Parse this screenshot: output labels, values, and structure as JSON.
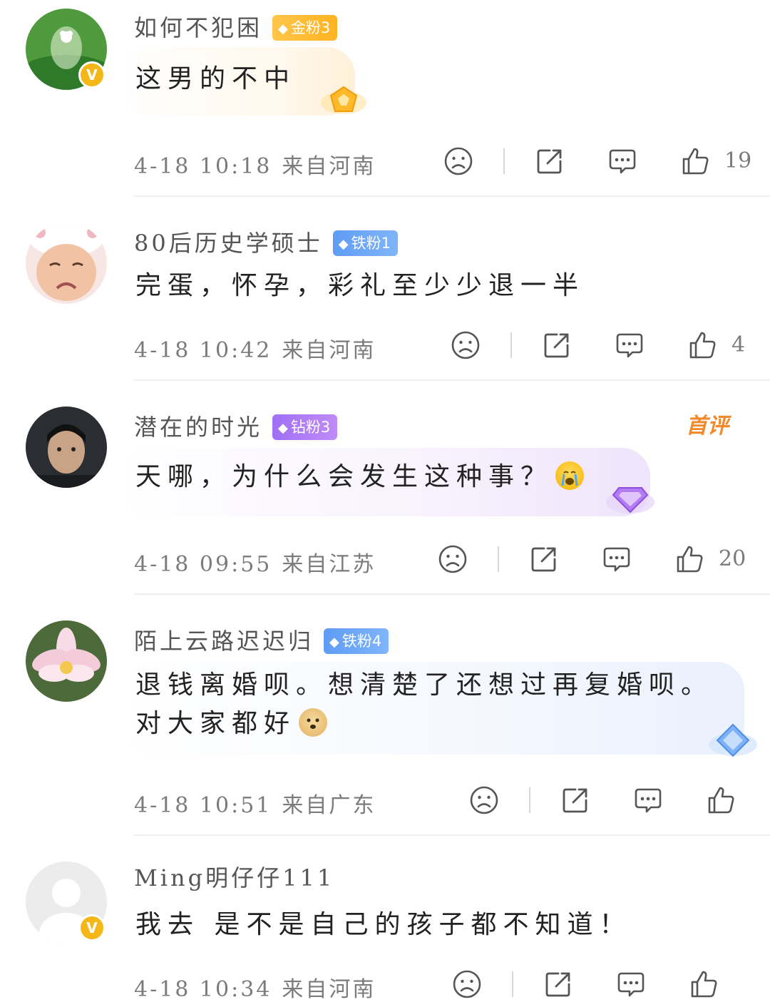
{
  "comments": [
    {
      "username": "如何不犯困",
      "badge": "金粉3",
      "text": "这男的不中",
      "time": "4-18 10:18",
      "location": "来自河南",
      "likes": "19",
      "verified": "V"
    },
    {
      "username": "80后历史学硕士",
      "badge": "铁粉1",
      "text": "完蛋，怀孕，彩礼至少少退一半",
      "time": "4-18 10:42",
      "location": "来自河南",
      "likes": "4"
    },
    {
      "username": "潜在的时光",
      "badge": "钻粉3",
      "text": "天哪，为什么会发生这种事？",
      "time": "4-18 09:55",
      "location": "来自江苏",
      "likes": "20",
      "tag": "首评"
    },
    {
      "username": "陌上云路迟迟归",
      "badge": "铁粉4",
      "text_line1": "退钱离婚呗。想清楚了还想过再复婚呗。",
      "text_line2": "对大家都好",
      "time": "4-18 10:51",
      "location": "来自广东",
      "likes": ""
    },
    {
      "username": "Ming明仔仔111",
      "text": "我去 是不是自己的孩子都不知道！",
      "time": "4-18 10:34",
      "location": "来自河南",
      "verified": "V"
    }
  ],
  "colors": {
    "gold_badge": "#ffb320",
    "iron_badge": "#5f9cf5",
    "diamond_badge": "#a070f5",
    "verified": "#f5b718",
    "first_comment_tag": "#f08a2c"
  },
  "icons": [
    "frown-icon",
    "share-icon",
    "comment-icon",
    "thumbs-up-icon"
  ]
}
